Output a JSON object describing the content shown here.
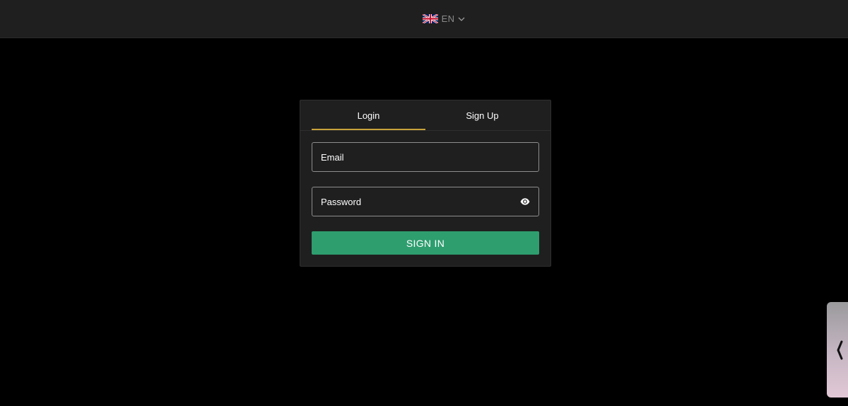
{
  "header": {
    "language": {
      "flag_icon": "uk-flag-icon",
      "code": "EN",
      "dropdown_icon": "chevron-down-icon"
    }
  },
  "auth": {
    "tabs": [
      {
        "label": "Login",
        "active": true
      },
      {
        "label": "Sign Up",
        "active": false
      }
    ],
    "email": {
      "placeholder": "Email",
      "value": ""
    },
    "password": {
      "placeholder": "Password",
      "value": "",
      "toggle_icon": "eye-icon"
    },
    "submit_label": "SIGN IN"
  },
  "side_panel": {
    "icon": "chevron-left-icon"
  },
  "colors": {
    "background": "#000000",
    "topbar": "#1f1f1f",
    "card": "#1f1f1f",
    "active_tab_underline": "#c8a23a",
    "primary_button": "#2e9e6f"
  }
}
